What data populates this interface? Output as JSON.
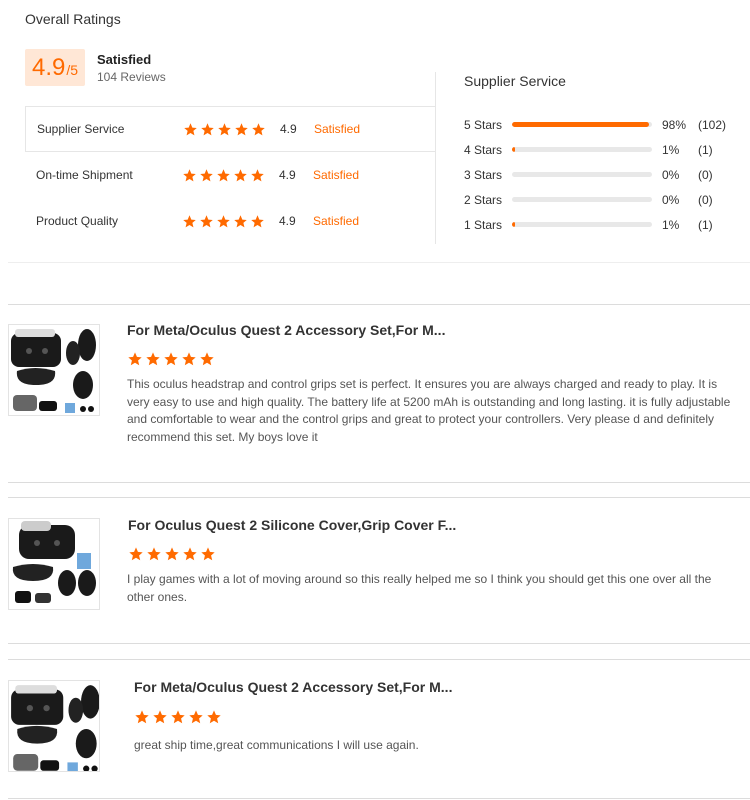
{
  "overall": {
    "title": "Overall Ratings",
    "score": "4.9",
    "score_max": "/5",
    "label": "Satisfied",
    "reviews": "104 Reviews"
  },
  "ratings": [
    {
      "label": "Supplier Service",
      "value": "4.9",
      "status": "Satisfied",
      "stars": 5
    },
    {
      "label": "On-time Shipment",
      "value": "4.9",
      "status": "Satisfied",
      "stars": 5
    },
    {
      "label": "Product Quality",
      "value": "4.9",
      "status": "Satisfied",
      "stars": 5
    }
  ],
  "distribution": {
    "title": "Supplier Service",
    "rows": [
      {
        "label": "5  Stars",
        "percent": "98%",
        "count": "(102)",
        "fill": 0.98
      },
      {
        "label": "4  Stars",
        "percent": "1%",
        "count": "(1)",
        "fill": 0.02
      },
      {
        "label": "3  Stars",
        "percent": "0%",
        "count": "(0)",
        "fill": 0
      },
      {
        "label": "2  Stars",
        "percent": "0%",
        "count": "(0)",
        "fill": 0
      },
      {
        "label": "1  Stars",
        "percent": "1%",
        "count": "(1)",
        "fill": 0.02
      }
    ]
  },
  "reviews": [
    {
      "title": "For Meta/Oculus Quest 2 Accessory Set,For M...",
      "stars": 5,
      "body": "This oculus headstrap and control grips set is perfect. It ensures you are always charged and ready to play. It is very easy to use and high quality. The battery life at 5200 mAh is outstanding and long lasting. it is fully adjustable and comfortable to wear and the control grips and great to protect your controllers. Very please d and definitely recommend this set. My boys love it"
    },
    {
      "title": "For Oculus Quest 2 Silicone Cover,Grip Cover F...",
      "stars": 5,
      "body": "I play games with a lot of moving around so this really helped me so I think you should get this one over all the other ones."
    },
    {
      "title": "For Meta/Oculus Quest 2 Accessory Set,For M...",
      "stars": 5,
      "body": "great ship time,great communications I will use again."
    }
  ],
  "colors": {
    "accent": "#ff6a00",
    "badge_bg": "#ffe7d6"
  },
  "icons": {
    "star": "star-icon",
    "product": "product-thumbnail"
  }
}
